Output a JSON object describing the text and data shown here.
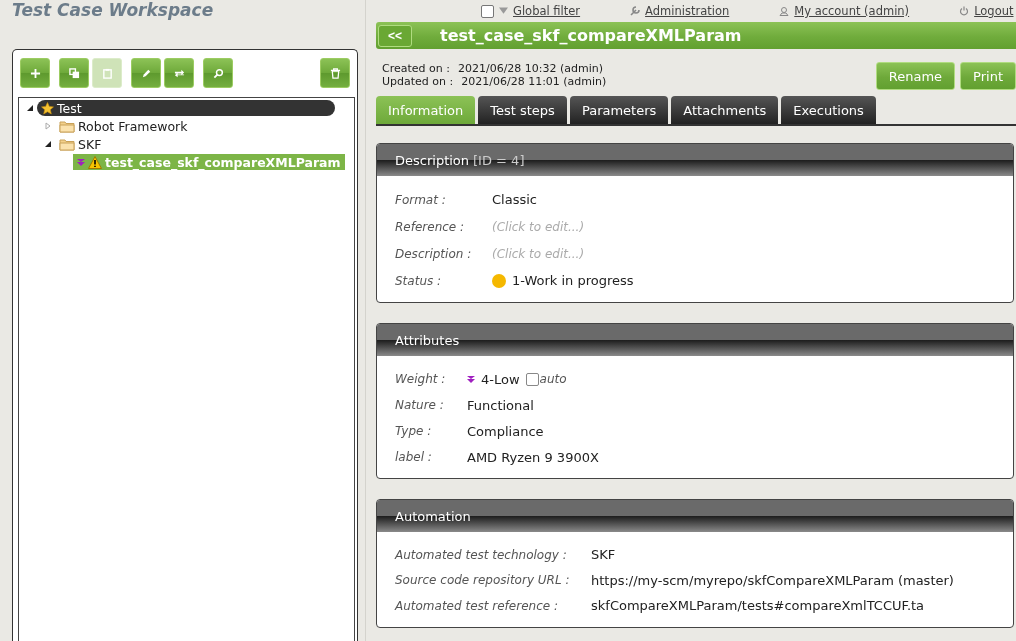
{
  "workspace_title": "Test Case Workspace",
  "toolbar": [
    {
      "buttons": [
        {
          "kind": "add",
          "disabled": false
        }
      ]
    },
    {
      "buttons": [
        {
          "kind": "copy",
          "disabled": false
        },
        {
          "kind": "paste",
          "disabled": true
        }
      ]
    },
    {
      "buttons": [
        {
          "kind": "edit",
          "disabled": false
        },
        {
          "kind": "swap",
          "disabled": false
        }
      ]
    },
    {
      "buttons": [
        {
          "kind": "search",
          "disabled": false
        }
      ]
    },
    {
      "buttons": [
        {
          "kind": "delete",
          "disabled": false
        }
      ]
    }
  ],
  "tree": [
    {
      "kind": "library",
      "label": "Test",
      "selected": false,
      "expanded": true,
      "children": [
        {
          "kind": "folder",
          "label": "Robot Framework",
          "selected": false,
          "expanded": false
        },
        {
          "kind": "folder",
          "label": "SKF",
          "selected": false,
          "expanded": true,
          "children": [
            {
              "kind": "testcase",
              "label": "test_case_skf_compareXMLParam",
              "selected": true
            }
          ]
        }
      ]
    }
  ],
  "top_menu": {
    "global_filter": {
      "label": "Global filter",
      "checked": false
    },
    "links": [
      {
        "kind": "admin",
        "label": "Administration"
      },
      {
        "kind": "account",
        "label": "My account (admin)"
      },
      {
        "kind": "logout",
        "label": "Logout"
      }
    ]
  },
  "header": {
    "back": "<<",
    "title": "test_case_skf_compareXMLParam"
  },
  "info": [
    {
      "label": "Created on :",
      "value": "2021/06/28 10:32 (admin)"
    },
    {
      "label": "Updated on :",
      "value": "2021/06/28 11:01 (admin)"
    }
  ],
  "actions": [
    "Rename",
    "Print"
  ],
  "tabs": [
    {
      "label": "Information",
      "selected": true
    },
    {
      "label": "Test steps",
      "selected": false
    },
    {
      "label": "Parameters",
      "selected": false
    },
    {
      "label": "Attachments",
      "selected": false
    },
    {
      "label": "Executions",
      "selected": false
    }
  ],
  "description": {
    "title": "Description",
    "id": "[ID = 4]",
    "rows": [
      {
        "kind": "text",
        "label": "Format :",
        "value": "Classic"
      },
      {
        "kind": "placeholder",
        "label": "Reference :",
        "placeholder": "(Click to edit...)"
      },
      {
        "kind": "placeholder",
        "label": "Description :",
        "placeholder": "(Click to edit...)"
      },
      {
        "kind": "status",
        "label": "Status :",
        "value": "1-Work in progress",
        "color": "#f5b800"
      }
    ]
  },
  "attributes": {
    "title": "Attributes",
    "rows": [
      {
        "kind": "weight",
        "label": "Weight :",
        "value": "4-Low",
        "auto_label": "auto",
        "auto_checked": false
      },
      {
        "kind": "text",
        "label": "Nature :",
        "value": "Functional"
      },
      {
        "kind": "text",
        "label": "Type  :",
        "value": "Compliance"
      },
      {
        "kind": "text",
        "label": "label :",
        "value": "AMD Ryzen 9 3900X"
      }
    ]
  },
  "automation": {
    "title": "Automation",
    "rows": [
      {
        "label": "Automated test technology   :",
        "value": "SKF"
      },
      {
        "label": "Source code repository URL  :",
        "value": "https://my-scm/myrepo/skfCompareXMLParam (master)"
      },
      {
        "label": "Automated test reference  :",
        "value": "skfCompareXMLParam/tests#compareXmlTCCUF.ta"
      }
    ]
  }
}
